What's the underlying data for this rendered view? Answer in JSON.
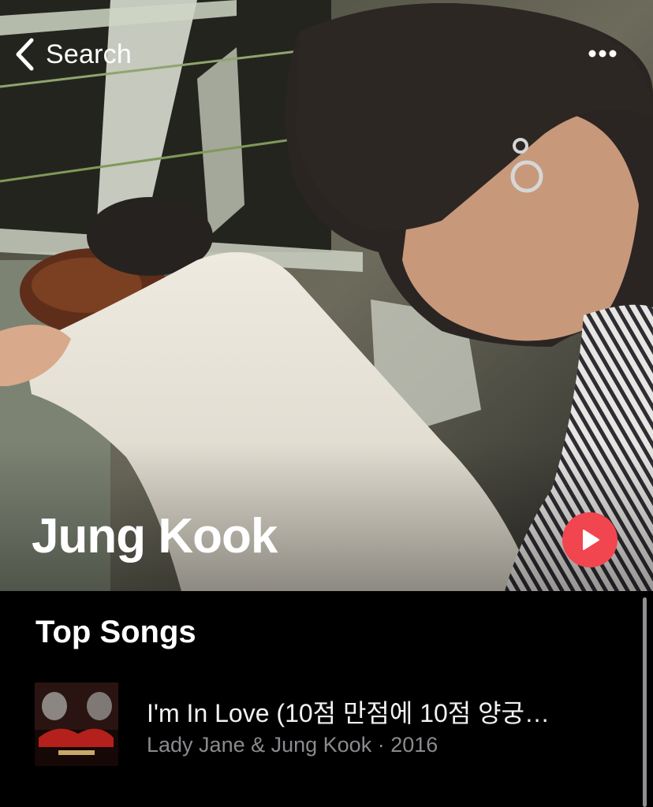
{
  "nav": {
    "back_label": "Search"
  },
  "header": {
    "artist_name": "Jung Kook"
  },
  "top_songs": {
    "title": "Top Songs",
    "songs": [
      {
        "title": "I'm In Love (10점 만점에 10점 양궁…",
        "subtitle": "Lady Jane & Jung Kook · 2016"
      }
    ]
  },
  "colors": {
    "accent": "#f1454f",
    "background": "#000000",
    "secondary_text": "#8b8b8f"
  },
  "icons": {
    "back": "chevron-left-icon",
    "more": "ellipsis-icon",
    "play": "play-icon"
  }
}
